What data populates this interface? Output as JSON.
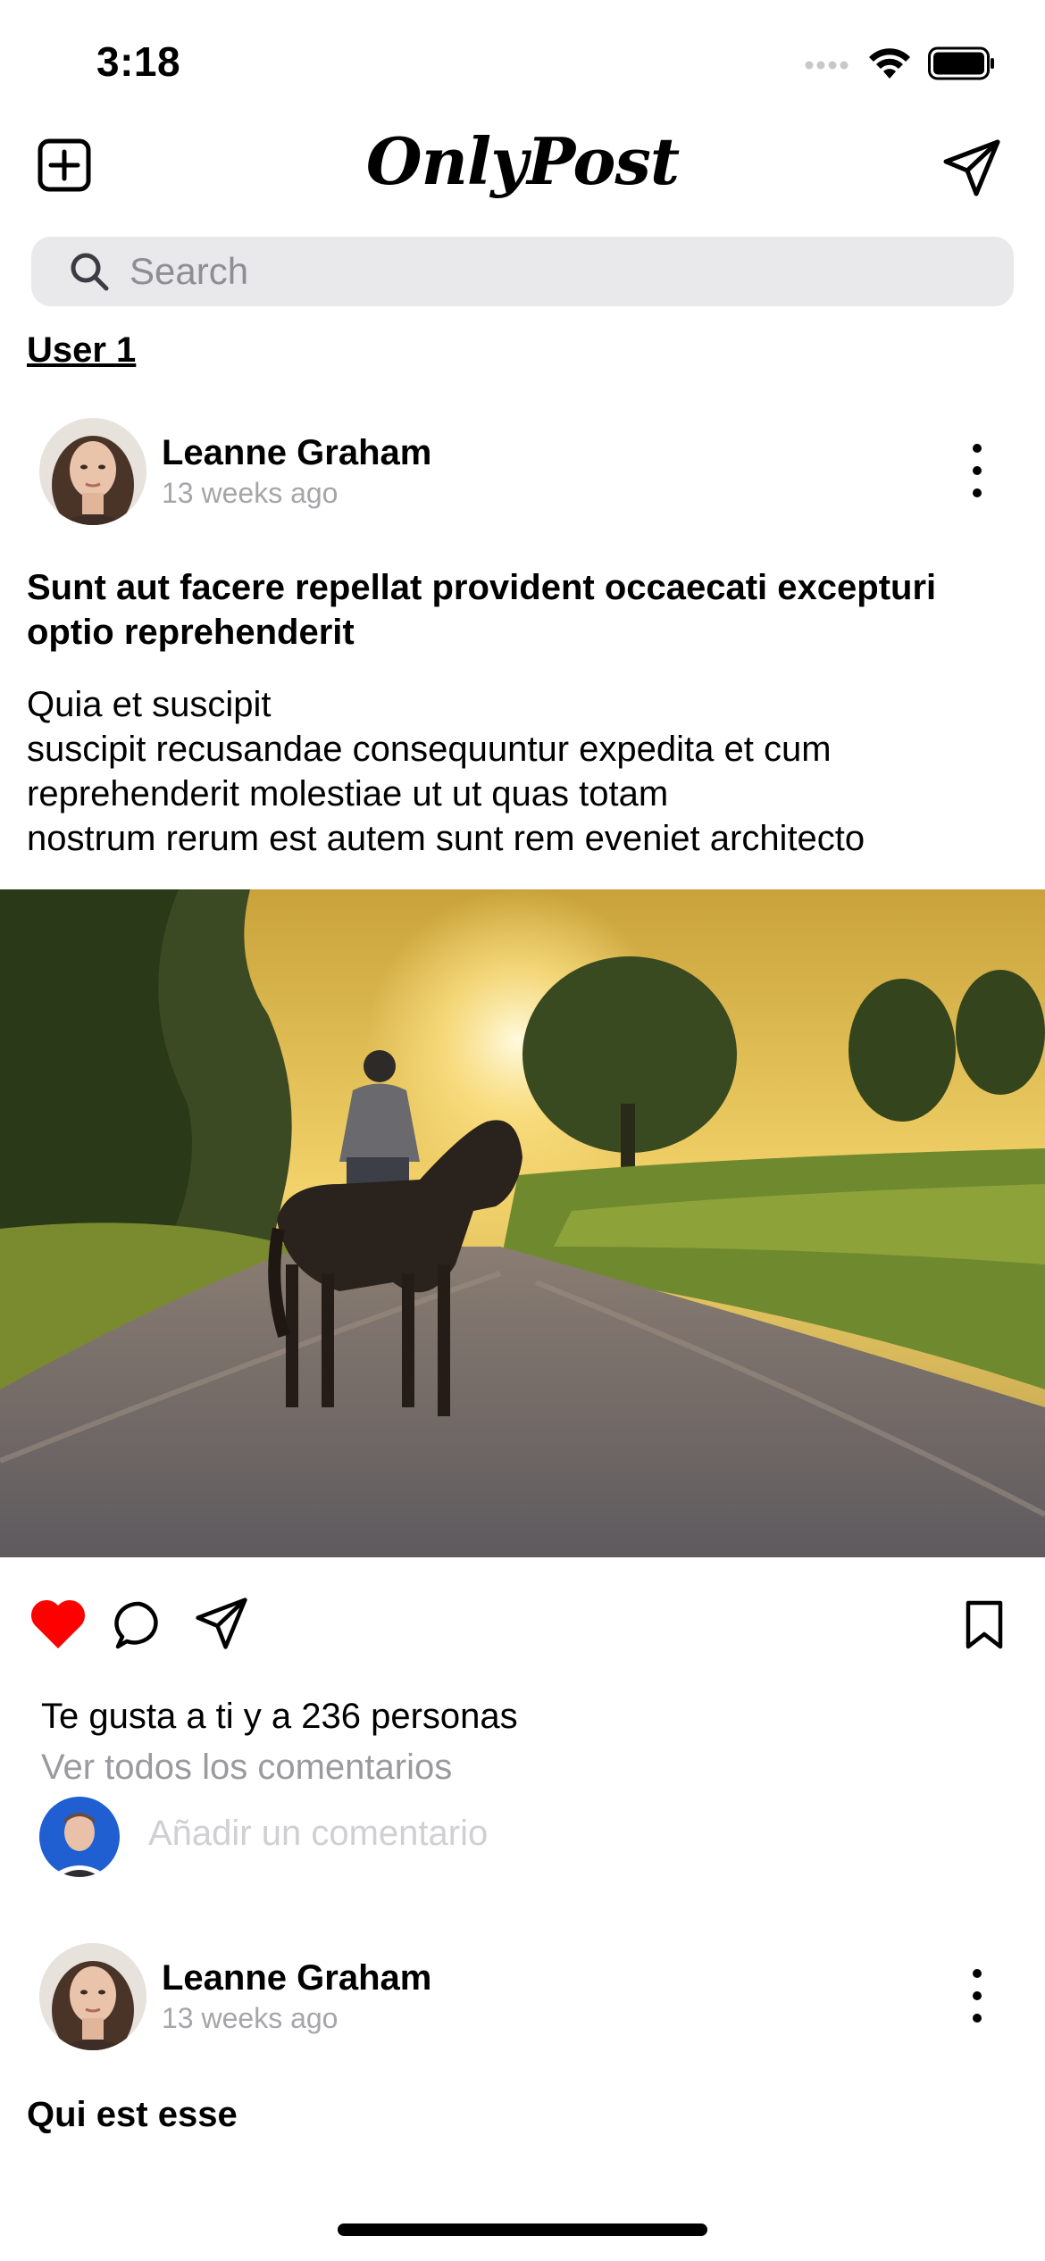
{
  "status_bar": {
    "time": "3:18"
  },
  "header": {
    "title": "OnlyPost"
  },
  "search": {
    "placeholder": "Search"
  },
  "section": {
    "user_label": "User 1"
  },
  "posts": [
    {
      "author": "Leanne Graham",
      "time_ago": "13 weeks ago",
      "title": "Sunt aut facere repellat provident occaecati excepturi optio reprehenderit",
      "body": "Quia et suscipit\nsuscipit recusandae consequuntur expedita et cum reprehenderit molestiae ut ut quas totam\nnostrum rerum est autem sunt rem eveniet architecto",
      "liked": true,
      "likes_text": "Te gusta a ti y a 236 personas",
      "view_comments": "Ver todos los comentarios",
      "comment_placeholder": "Añadir un comentario"
    },
    {
      "author": "Leanne Graham",
      "time_ago": "13 weeks ago",
      "title": "Qui est esse"
    }
  ],
  "colors": {
    "like": "#ff0000",
    "search_bg": "#e9e9eb",
    "muted_text": "#9b9b9f"
  },
  "icons": {
    "new_post": "plus-square-icon",
    "direct": "paper-plane-icon",
    "search": "search-icon",
    "more": "more-vertical-icon",
    "like": "heart-icon",
    "comment": "comment-bubble-icon",
    "share": "paper-plane-icon",
    "save": "bookmark-icon"
  }
}
